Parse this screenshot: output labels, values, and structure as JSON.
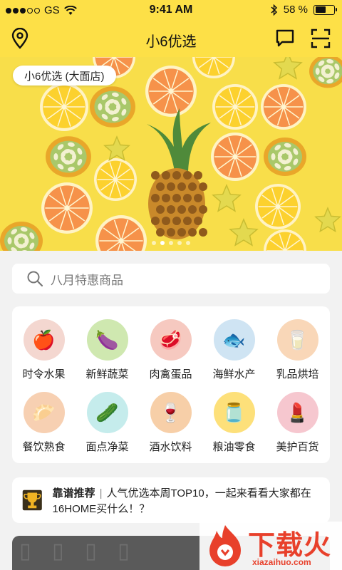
{
  "status": {
    "carrier": "GS",
    "time": "9:41 AM",
    "battery": "58 %",
    "battery_level": 0.58
  },
  "nav": {
    "title": "小6优选",
    "left_icon": "location-pin-icon",
    "right_icons": [
      "message-icon",
      "scan-icon"
    ]
  },
  "banner": {
    "store_label": "小6优选 (大面店)",
    "page_count": 5,
    "active_page": 1
  },
  "search": {
    "placeholder": "八月特惠商品"
  },
  "categories": [
    {
      "label": "时令水果",
      "icon": "fruit-icon",
      "bg": "#f4d7d0"
    },
    {
      "label": "新鲜蔬菜",
      "icon": "vegetable-icon",
      "bg": "#cfe8b0"
    },
    {
      "label": "肉禽蛋品",
      "icon": "meat-icon",
      "bg": "#f6c9c0"
    },
    {
      "label": "海鲜水产",
      "icon": "seafood-icon",
      "bg": "#cfe4f3"
    },
    {
      "label": "乳品烘培",
      "icon": "milk-icon",
      "bg": "#f9d7b8"
    },
    {
      "label": "餐饮熟食",
      "icon": "dumpling-icon",
      "bg": "#f7d0b2"
    },
    {
      "label": "面点净菜",
      "icon": "cucumber-icon",
      "bg": "#c5ecec"
    },
    {
      "label": "酒水饮料",
      "icon": "wine-icon",
      "bg": "#f7cfa8"
    },
    {
      "label": "粮油零食",
      "icon": "oil-icon",
      "bg": "#fde07a"
    },
    {
      "label": "美护百货",
      "icon": "cosmetics-icon",
      "bg": "#f6c7cf"
    }
  ],
  "recommend": {
    "tag": "靠谱推荐",
    "separator": "|",
    "text": "人气优选本周TOP10，一起来看看大家都在16HOME买什么！？",
    "icon": "trophy-icon"
  },
  "watermark": {
    "title": "下载火",
    "url": "xiazaihuo.com"
  },
  "colors": {
    "brand_yellow": "#fde047",
    "background": "#f2f2f2",
    "watermark_red": "#e8402b"
  }
}
